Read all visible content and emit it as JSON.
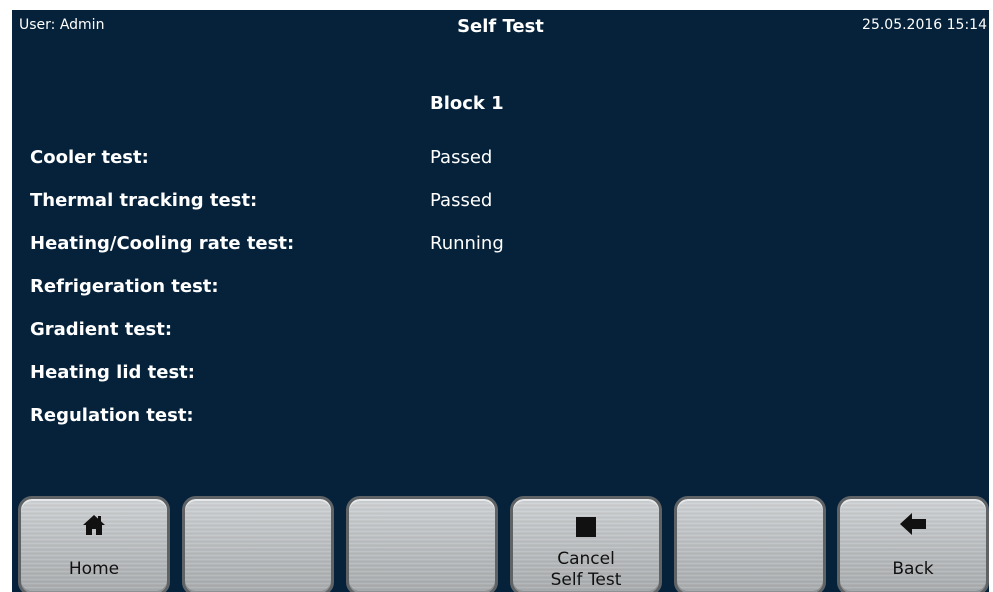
{
  "header": {
    "user": "User: Admin",
    "title": "Self Test",
    "datetime": "25.05.2016 15:14"
  },
  "block": {
    "label": "Block 1"
  },
  "tests": [
    {
      "name": "Cooler test:",
      "status": "Passed"
    },
    {
      "name": "Thermal tracking test:",
      "status": "Passed"
    },
    {
      "name": "Heating/Cooling rate test:",
      "status": "Running"
    },
    {
      "name": "Refrigeration test:",
      "status": ""
    },
    {
      "name": "Gradient test:",
      "status": ""
    },
    {
      "name": "Heating lid test:",
      "status": ""
    },
    {
      "name": "Regulation test:",
      "status": ""
    }
  ],
  "buttons": {
    "home": {
      "label": "Home",
      "icon": "home-icon"
    },
    "empty_2": {
      "label": ""
    },
    "empty_3": {
      "label": ""
    },
    "cancel": {
      "label_line1": "Cancel",
      "label_line2": "Self Test",
      "icon": "stop-icon"
    },
    "empty_5": {
      "label": ""
    },
    "back": {
      "label": "Back",
      "icon": "back-arrow-icon"
    }
  },
  "colors": {
    "screen_background": "#05223a",
    "text": "#ffffff",
    "button_face": "#c0c3c5"
  }
}
